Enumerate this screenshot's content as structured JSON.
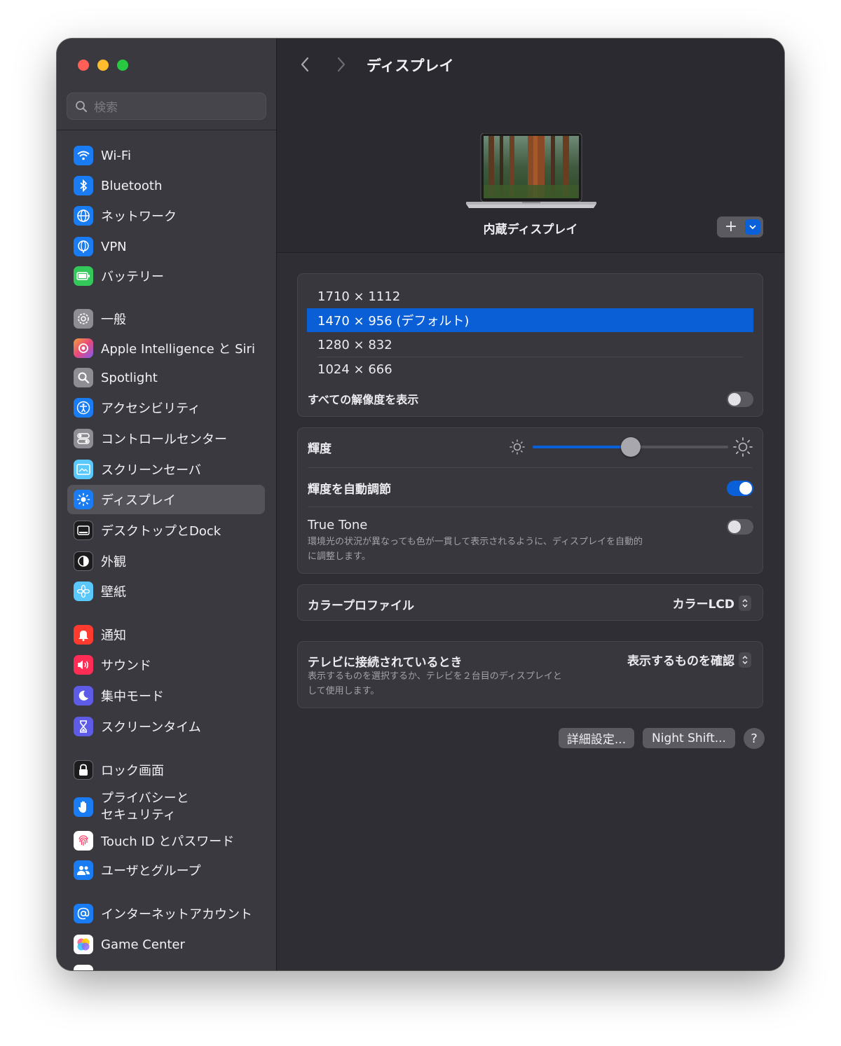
{
  "window": {
    "title": "ディスプレイ"
  },
  "search": {
    "placeholder": "検索"
  },
  "sidebar": {
    "items": [
      {
        "label": "Wi-Fi",
        "icon": "wifi-icon"
      },
      {
        "label": "Bluetooth",
        "icon": "bluetooth-icon"
      },
      {
        "label": "ネットワーク",
        "icon": "globe-icon"
      },
      {
        "label": "VPN",
        "icon": "vpn-globe-icon"
      },
      {
        "label": "バッテリー",
        "icon": "battery-icon"
      },
      {
        "label": "一般",
        "icon": "gear-icon"
      },
      {
        "label": "Apple Intelligence と Siri",
        "icon": "siri-icon"
      },
      {
        "label": "Spotlight",
        "icon": "magnifier-icon"
      },
      {
        "label": "アクセシビリティ",
        "icon": "accessibility-icon"
      },
      {
        "label": "コントロールセンター",
        "icon": "toggles-icon"
      },
      {
        "label": "スクリーンセーバ",
        "icon": "screensaver-icon"
      },
      {
        "label": "ディスプレイ",
        "icon": "brightness-icon",
        "active": true
      },
      {
        "label": "デスクトップとDock",
        "icon": "dock-icon"
      },
      {
        "label": "外観",
        "icon": "appearance-icon"
      },
      {
        "label": "壁紙",
        "icon": "flower-icon"
      },
      {
        "label": "通知",
        "icon": "bell-icon"
      },
      {
        "label": "サウンド",
        "icon": "speaker-icon"
      },
      {
        "label": "集中モード",
        "icon": "moon-icon"
      },
      {
        "label": "スクリーンタイム",
        "icon": "hourglass-icon"
      },
      {
        "label": "ロック画面",
        "icon": "lock-icon"
      },
      {
        "label": "プライバシーと\nセキュリティ",
        "icon": "hand-icon"
      },
      {
        "label": "Touch ID とパスワード",
        "icon": "fingerprint-icon"
      },
      {
        "label": "ユーザとグループ",
        "icon": "users-icon"
      },
      {
        "label": "インターネットアカウント",
        "icon": "at-icon"
      },
      {
        "label": "Game Center",
        "icon": "game-center-icon"
      }
    ]
  },
  "display": {
    "name": "内蔵ディスプレイ"
  },
  "resolutions": {
    "options": [
      "1710 × 1112",
      "1470 × 956 (デフォルト)",
      "1280 × 832",
      "1024 × 666"
    ],
    "selected_index": 1,
    "show_all_label": "すべての解像度を表示",
    "show_all_on": false
  },
  "brightness": {
    "label": "輝度",
    "level": 0.5
  },
  "auto_brightness": {
    "label": "輝度を自動調節",
    "on": true
  },
  "true_tone": {
    "label": "True Tone",
    "description_line1": "環境光の状況が異なっても色が一貫して表示されるように、ディスプレイを自動的",
    "description_line2": "に調整します。",
    "on": false
  },
  "color_profile": {
    "label": "カラープロファイル",
    "value": "カラーLCD"
  },
  "tv": {
    "label": "テレビに接続されているとき",
    "description_line1": "表示するものを選択するか、テレビを２台目のディスプレイと",
    "description_line2": "して使用します。",
    "value": "表示するものを確認"
  },
  "buttons": {
    "advanced": "詳細設定...",
    "night_shift": "Night Shift...",
    "help": "?"
  },
  "colors": {
    "accent": "#0a60d8",
    "sidebar_bg": "#3a393f",
    "content_bg": "#2f2e34"
  }
}
